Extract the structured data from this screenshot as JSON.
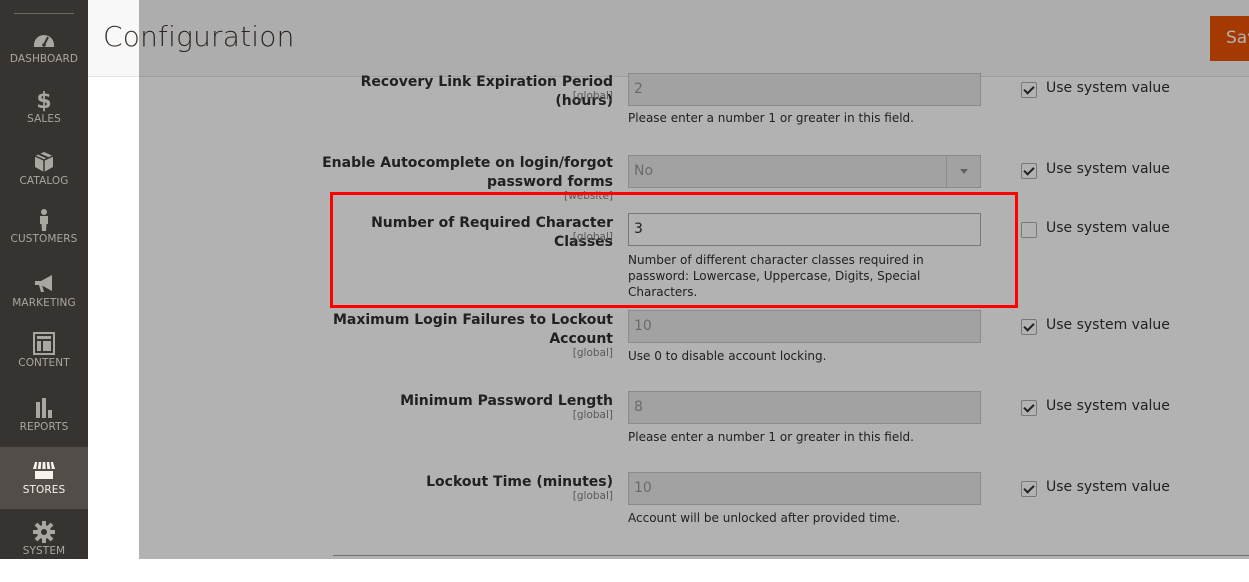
{
  "sidebar": {
    "items": [
      {
        "label": "DASHBOARD",
        "icon": "dashboard-icon",
        "active": false
      },
      {
        "label": "SALES",
        "icon": "dollar-icon",
        "active": false
      },
      {
        "label": "CATALOG",
        "icon": "box-icon",
        "active": false
      },
      {
        "label": "CUSTOMERS",
        "icon": "person-icon",
        "active": false
      },
      {
        "label": "MARKETING",
        "icon": "megaphone-icon",
        "active": false
      },
      {
        "label": "CONTENT",
        "icon": "layout-icon",
        "active": false
      },
      {
        "label": "REPORTS",
        "icon": "bar-chart-icon",
        "active": false
      },
      {
        "label": "STORES",
        "icon": "storefront-icon",
        "active": true
      },
      {
        "label": "SYSTEM",
        "icon": "gear-icon",
        "active": false
      }
    ]
  },
  "header": {
    "title": "Configuration",
    "save_label": "Save Config"
  },
  "fields": [
    {
      "label": "Recovery Link Expiration Period (hours)",
      "scope": "[global]",
      "type": "text",
      "value": "2",
      "disabled": true,
      "note": "Please enter a number 1 or greater in this field.",
      "use_system_value": true
    },
    {
      "label": "Enable Autocomplete on login/forgot password forms",
      "scope": "[website]",
      "type": "select",
      "value": "No",
      "disabled": true,
      "note": "",
      "use_system_value": true
    },
    {
      "label": "Number of Required Character Classes",
      "scope": "[global]",
      "type": "text",
      "value": "3",
      "disabled": false,
      "note": "Number of different character classes required in password: Lowercase, Uppercase, Digits, Special Characters.",
      "use_system_value": false,
      "highlighted": true
    },
    {
      "label": "Maximum Login Failures to Lockout Account",
      "scope": "[global]",
      "type": "text",
      "value": "10",
      "disabled": true,
      "note": "Use 0 to disable account locking.",
      "use_system_value": true
    },
    {
      "label": "Minimum Password Length",
      "scope": "[global]",
      "type": "text",
      "value": "8",
      "disabled": true,
      "note": "Please enter a number 1 or greater in this field.",
      "use_system_value": true
    },
    {
      "label": "Lockout Time (minutes)",
      "scope": "[global]",
      "type": "text",
      "value": "10",
      "disabled": true,
      "note": "Account will be unlocked after provided time.",
      "use_system_value": true
    }
  ],
  "use_system_value_label": "Use system value",
  "colors": {
    "sidebar_bg": "#373330",
    "sidebar_active": "#524d49",
    "save_button": "#eb5202",
    "highlight": "#ff0000"
  }
}
